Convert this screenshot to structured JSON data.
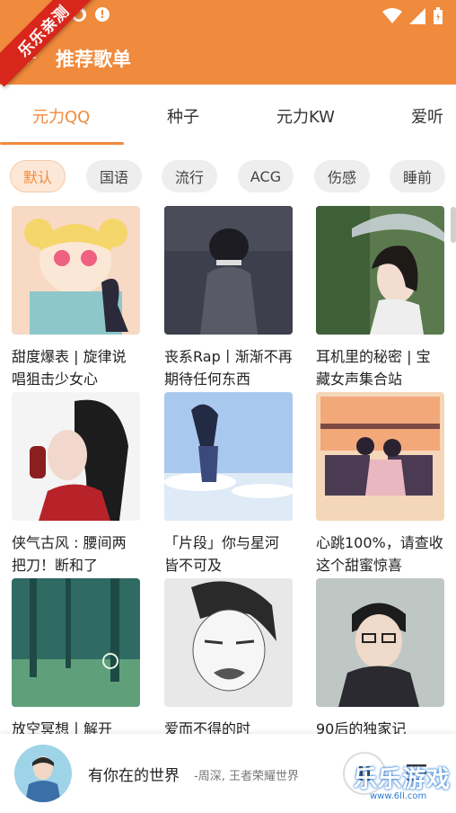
{
  "status_bar": {
    "icons": [
      "notification-icon",
      "alert-icon",
      "wifi-icon",
      "battery-icon"
    ]
  },
  "toolbar": {
    "title": "推荐歌单",
    "back_icon": "back-arrow-icon"
  },
  "ribbon": {
    "text": "乐乐亲测"
  },
  "tabs": [
    {
      "label": "元力QQ",
      "active": true
    },
    {
      "label": "种子",
      "active": false
    },
    {
      "label": "元力KW",
      "active": false
    },
    {
      "label": "爱听",
      "active": false
    }
  ],
  "chips": [
    {
      "label": "默认",
      "active": true
    },
    {
      "label": "国语",
      "active": false
    },
    {
      "label": "流行",
      "active": false
    },
    {
      "label": "ACG",
      "active": false
    },
    {
      "label": "伤感",
      "active": false
    },
    {
      "label": "睡前",
      "active": false
    }
  ],
  "playlists": [
    {
      "title": "甜度爆表 | 旋律说唱狙击少女心"
    },
    {
      "title": "丧系Rap丨渐渐不再期待任何东西"
    },
    {
      "title": "耳机里的秘密 | 宝藏女声集合站"
    },
    {
      "title": "侠气古风 : 腰间两把刀！断和了"
    },
    {
      "title": "「片段」你与星河皆不可及"
    },
    {
      "title": "心跳100%，请查收这个甜蜜惊喜"
    },
    {
      "title": "放空冥想丨解开"
    },
    {
      "title": "爱而不得的时"
    },
    {
      "title": "90后的独家记"
    }
  ],
  "player": {
    "song": "有你在的世界",
    "artist": "-周深, 王者荣耀世界",
    "play_icon": "pause-icon",
    "list_icon": "playlist-icon"
  },
  "watermark": {
    "text": "乐乐游戏",
    "url": "www.6ll.com"
  },
  "colors": {
    "accent": "#f08a3c",
    "ribbon": "#d9261c"
  }
}
